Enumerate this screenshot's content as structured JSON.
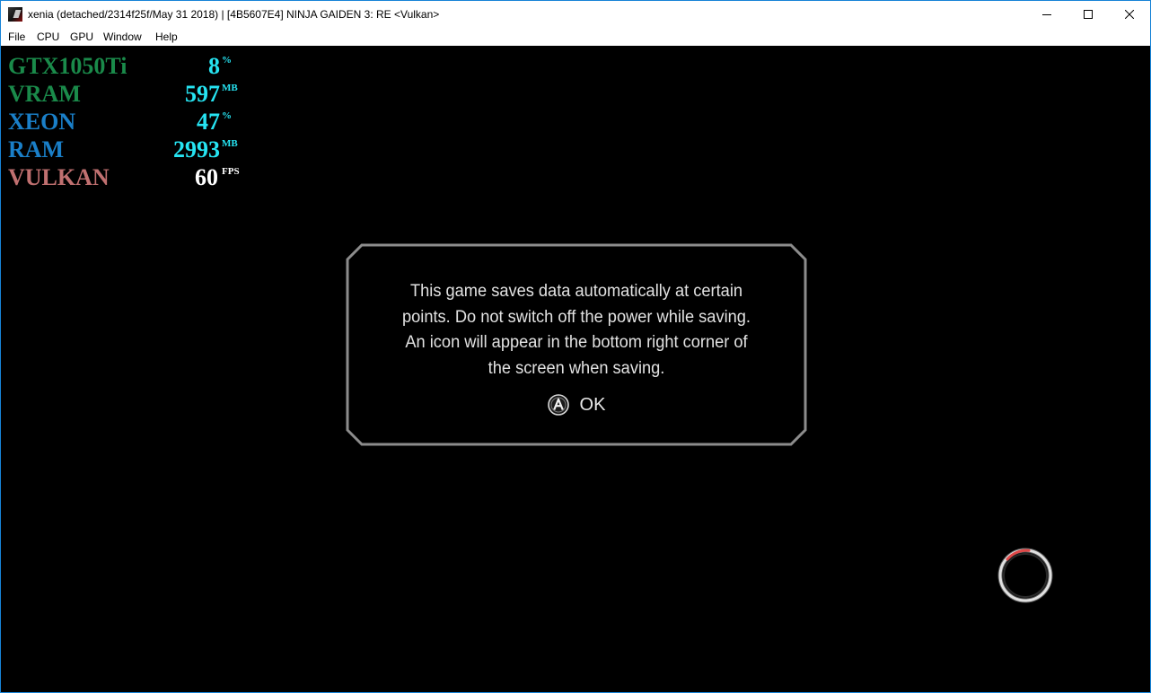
{
  "window": {
    "title": "xenia (detached/2314f25f/May 31 2018) | [4B5607E4] NINJA GAIDEN 3: RE <Vulkan>",
    "icon": "xenia-app-icon",
    "controls": [
      "minimize-icon",
      "maximize-icon",
      "close-icon"
    ]
  },
  "menu": {
    "items": [
      "File",
      "CPU",
      "GPU",
      "Window",
      "Help"
    ]
  },
  "osd": {
    "rows": [
      {
        "label": "GTX1050Ti",
        "value": "8",
        "unit": "%",
        "label_color": "#1a8a4a",
        "value_color": "#26e4f2"
      },
      {
        "label": "VRAM",
        "value": "597",
        "unit": "MB",
        "label_color": "#1a8a4a",
        "value_color": "#26e4f2"
      },
      {
        "label": "XEON",
        "value": "47",
        "unit": "%",
        "label_color": "#1a7fc8",
        "value_color": "#26e4f2"
      },
      {
        "label": "RAM",
        "value": "2993",
        "unit": "MB",
        "label_color": "#1a7fc8",
        "value_color": "#26e4f2"
      },
      {
        "label": "VULKAN",
        "value": "60",
        "unit": "FPS",
        "label_color": "#c07070",
        "value_color": "#ffffff"
      }
    ]
  },
  "dialog": {
    "lines": [
      "This game saves data automatically at certain",
      "points. Do not switch off the power while saving.",
      "An icon will appear in the bottom right corner of",
      "the screen when saving."
    ],
    "ok_icon": "a-button-icon",
    "ok_label": "OK"
  },
  "saving_indicator": {
    "icon": "saving-spinner-icon"
  }
}
